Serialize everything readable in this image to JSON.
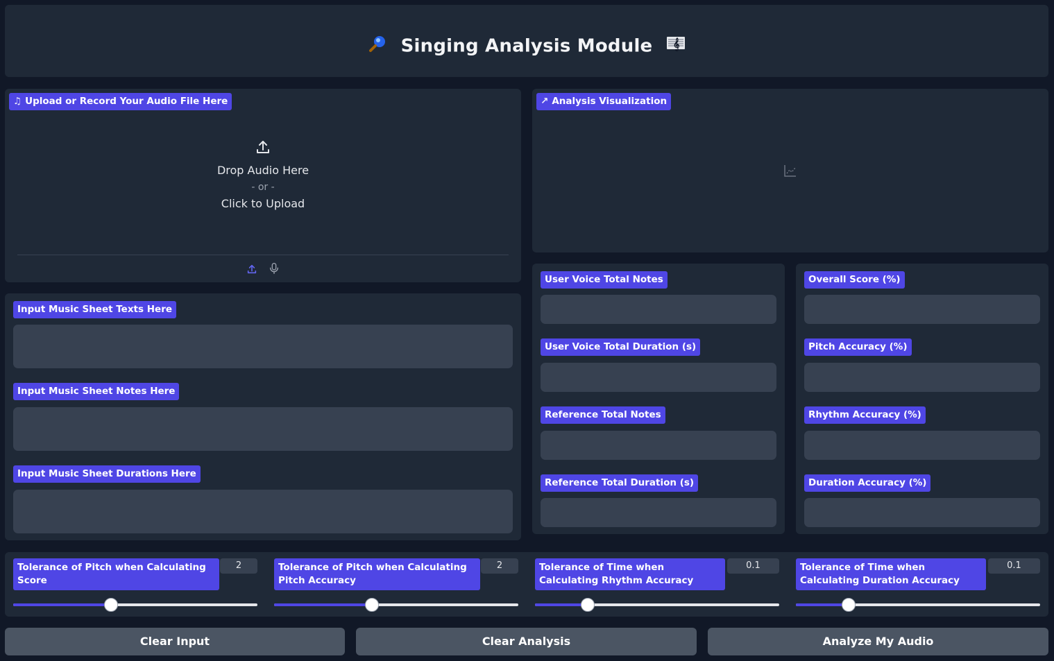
{
  "header": {
    "title": "Singing Analysis Module",
    "left_icon": "magnifier-icon",
    "right_icon": "music-score-icon"
  },
  "upload": {
    "label": "Upload or Record Your Audio File Here",
    "drop_text": "Drop Audio Here",
    "or_text": "- or -",
    "click_text": "Click to Upload"
  },
  "visualization": {
    "label": "Analysis Visualization"
  },
  "inputs": {
    "texts_label": "Input Music Sheet Texts Here",
    "notes_label": "Input Music Sheet Notes Here",
    "durations_label": "Input Music Sheet Durations Here"
  },
  "stats_left": {
    "user_notes_label": "User Voice Total Notes",
    "user_duration_label": "User Voice Total Duration (s)",
    "ref_notes_label": "Reference Total Notes",
    "ref_duration_label": "Reference Total Duration (s)"
  },
  "stats_right": {
    "overall_label": "Overall Score (%)",
    "pitch_label": "Pitch Accuracy (%)",
    "rhythm_label": "Rhythm Accuracy (%)",
    "duration_label": "Duration Accuracy (%)"
  },
  "sliders": [
    {
      "label": "Tolerance of Pitch when Calculating Score",
      "value": "2",
      "fraction": 0.4
    },
    {
      "label": "Tolerance of Pitch when Calculating Pitch Accuracy",
      "value": "2",
      "fraction": 0.4
    },
    {
      "label": "Tolerance of Time when Calculating Rhythm Accuracy",
      "value": "0.1",
      "fraction": 0.215
    },
    {
      "label": "Tolerance of Time when Calculating Duration Accuracy",
      "value": "0.1",
      "fraction": 0.215
    }
  ],
  "buttons": {
    "clear_input": "Clear Input",
    "clear_analysis": "Clear Analysis",
    "analyze": "Analyze My Audio"
  },
  "colors": {
    "background": "#111827",
    "panel": "#1f2937",
    "field": "#374151",
    "accent": "#4f46e5",
    "button": "#4b5563"
  }
}
